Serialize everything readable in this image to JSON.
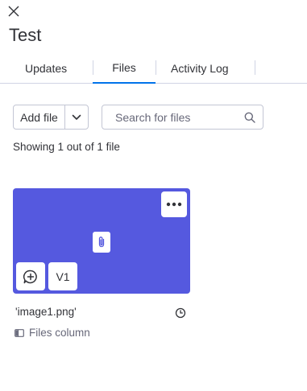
{
  "header": {
    "title": "Test"
  },
  "tabs": [
    {
      "label": "Updates",
      "active": false
    },
    {
      "label": "Files",
      "active": true
    },
    {
      "label": "Activity Log",
      "active": false
    }
  ],
  "toolbar": {
    "add_file_label": "Add file",
    "search_placeholder": "Search for files"
  },
  "summary": {
    "showing_text": "Showing 1 out of 1 file"
  },
  "files": [
    {
      "name": "'image1.png'",
      "version": "V1",
      "column": "Files column",
      "thumbnail_color": "#5559df"
    }
  ],
  "colors": {
    "accent": "#0073ea",
    "card": "#5559df",
    "text": "#323338",
    "muted": "#676879"
  }
}
